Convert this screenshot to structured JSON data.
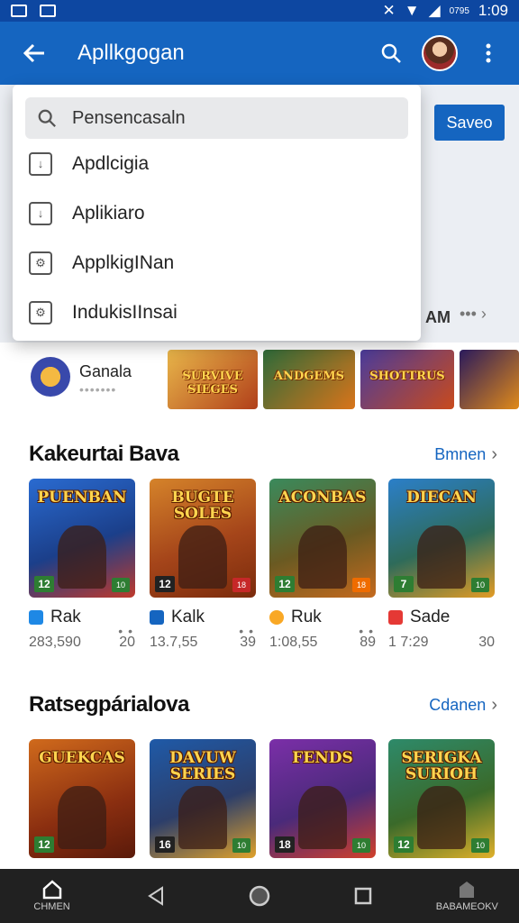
{
  "status_bar": {
    "time": "1:09",
    "extra": "0795"
  },
  "app_bar": {
    "title": "Apllkgogan"
  },
  "save_label": "Saveo",
  "peek": {
    "label": "AM",
    "dots": "••• ›"
  },
  "search": {
    "placeholder": "Pensencasaln"
  },
  "menu_items": [
    {
      "label": "Apdlcigia",
      "icon": "download-icon"
    },
    {
      "label": "Aplikiaro",
      "icon": "download-icon"
    },
    {
      "label": "ApplkigINan",
      "icon": "settings-search-icon"
    },
    {
      "label": "IndukisIInsai",
      "icon": "settings-search-icon"
    }
  ],
  "banner": {
    "title": "Ganala",
    "subtitle": "•••••••",
    "tiles": [
      {
        "title": "SURVIVE SIEGES",
        "colors": [
          "#e8b64a",
          "#b13f1a"
        ]
      },
      {
        "title": "ANDGEMS",
        "colors": [
          "#2e6b3a",
          "#d9741a"
        ]
      },
      {
        "title": "SHOTTRUS",
        "colors": [
          "#4a3c9c",
          "#c94a1c"
        ]
      },
      {
        "title": "",
        "colors": [
          "#2a1a5c",
          "#e08a1a"
        ]
      }
    ]
  },
  "section1": {
    "title": "Kakeurtai Bava",
    "link": "Bmnen",
    "cards": [
      {
        "art": "PUENBAN",
        "age": "12",
        "colors": [
          "#2a6bd1",
          "#c0392b"
        ],
        "name": "Rak",
        "ico": "#1e88e5",
        "count": "283,590",
        "size": "20",
        "dots": "• •\n• •"
      },
      {
        "art": "BUGTE SOLES",
        "age": "12",
        "colors": [
          "#d5832a",
          "#7a2b0c"
        ],
        "name": "Kalk",
        "ico": "#1565c0",
        "count": "13.7,55",
        "size": "39",
        "dots": "• •"
      },
      {
        "art": "ACONBAS",
        "age": "12",
        "colors": [
          "#3a8a5c",
          "#c56a1e"
        ],
        "name": "Ruk",
        "ico": "#f9a825",
        "count": "1:08,55",
        "size": "89",
        "dots": "• •"
      },
      {
        "art": "DIECAN",
        "age": "7",
        "colors": [
          "#2b7fc9",
          "#e39b24"
        ],
        "name": "Sade",
        "ico": "#e53935",
        "count": "1 7:29",
        "size": "30",
        "dots": "• •"
      }
    ]
  },
  "section2": {
    "title": "Ratsegpárialova",
    "link": "Cdanen",
    "cards": [
      {
        "art": "GUEKCAS",
        "age": "12",
        "colors": [
          "#d06a1c",
          "#5a1a0a"
        ]
      },
      {
        "art": "DAVUW SERIES",
        "age": "16",
        "colors": [
          "#1f5aa8",
          "#e0a12a"
        ]
      },
      {
        "art": "FENDS",
        "age": "18",
        "colors": [
          "#7b2fa8",
          "#d1402a"
        ]
      },
      {
        "art": "SERIGKA SURIOH",
        "age": "12",
        "colors": [
          "#2e8a6a",
          "#e0b02a"
        ]
      }
    ]
  },
  "bottom_nav": {
    "home": "CHMEN",
    "right": "BABAMEOKV"
  }
}
